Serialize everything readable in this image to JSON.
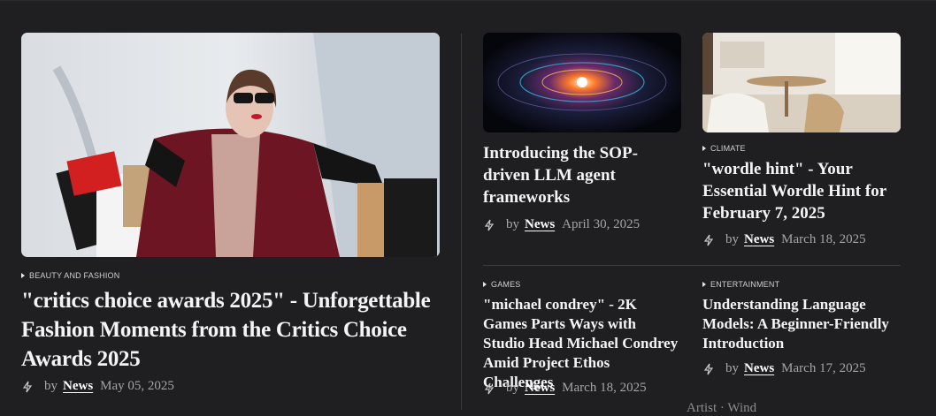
{
  "featured": {
    "category": "BEAUTY AND FASHION",
    "title": "\"critics choice awards 2025\" - Unforgettable Fashion Moments from the Critics Choice Awards 2025",
    "by": "by",
    "author": "News",
    "date": "May 05, 2025",
    "image_icon": "fashion-photo"
  },
  "card_llm": {
    "title": "Introducing the SOP-driven LLM agent frameworks",
    "by": "by",
    "author": "News",
    "date": "April 30, 2025"
  },
  "card_wordle": {
    "category": "CLIMATE",
    "title": "\"wordle hint\" - Your Essential Wordle Hint for February 7, 2025",
    "by": "by",
    "author": "News",
    "date": "March 18, 2025"
  },
  "card_games": {
    "category": "GAMES",
    "title": "\"michael condrey\" - 2K Games Parts Ways with Studio Head Michael Condrey Amid Project Ethos Challenges",
    "by": "by",
    "author": "News",
    "date": "March 18, 2025"
  },
  "card_llm2": {
    "category": "ENTERTAINMENT",
    "title": "Understanding Language Models: A Beginner-Friendly Introduction",
    "by": "by",
    "author": "News",
    "date": "March 17, 2025"
  },
  "cutoff_text": "Artist · Wind",
  "colors": {
    "background": "#1f1f22",
    "meta": "#a9a9ad",
    "accent_text": "#ffffff"
  }
}
